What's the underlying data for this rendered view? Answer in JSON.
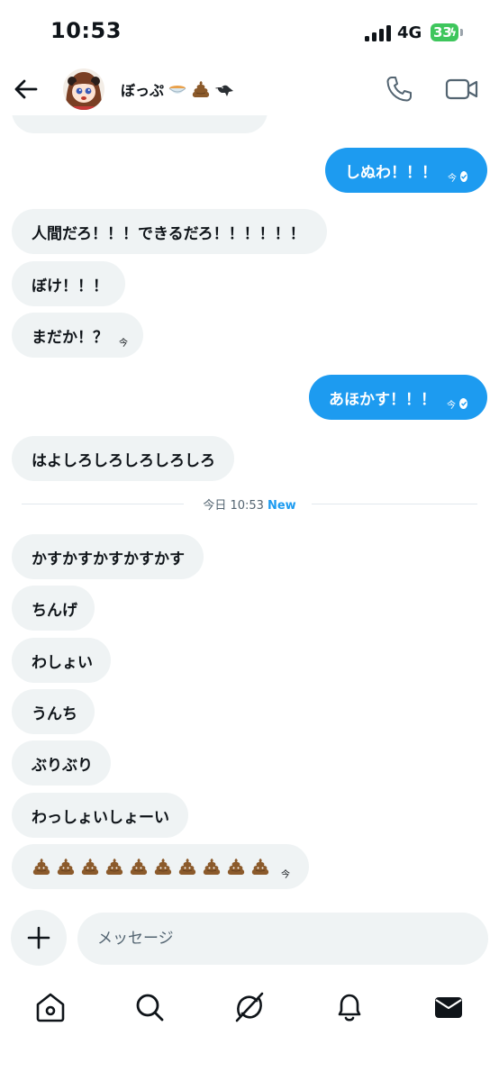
{
  "status": {
    "time": "10:53",
    "network": "4G",
    "battery": "33"
  },
  "header": {
    "name": "ぼっぷ",
    "name_emoji": [
      "bowl-emoji",
      "poop-emoji",
      "crow-emoji"
    ]
  },
  "messages": [
    {
      "side": "recv",
      "text": "",
      "partial": true
    },
    {
      "side": "sent",
      "text": "しぬわ！！！",
      "time": "今",
      "read": true
    },
    {
      "side": "recv",
      "text": "人間だろ！！！できるだろ！！！！！！"
    },
    {
      "side": "recv",
      "text": "ぼけ！！！"
    },
    {
      "side": "recv",
      "text": "まだか！？",
      "time": "今"
    },
    {
      "side": "sent",
      "text": "あほかす！！！",
      "time": "今",
      "read": true
    },
    {
      "side": "recv",
      "text": "はよしろしろしろしろしろ"
    },
    {
      "side": "recv",
      "text": "かすかすかすかすかす"
    },
    {
      "side": "recv",
      "text": "ちんげ"
    },
    {
      "side": "recv",
      "text": "わしょい"
    },
    {
      "side": "recv",
      "text": "うんち"
    },
    {
      "side": "recv",
      "text": "ぶりぶり"
    },
    {
      "side": "recv",
      "text": "わっしょいしょーい"
    },
    {
      "side": "recv",
      "emoji_count": 10,
      "emoji": "poop-emoji",
      "time": "今"
    }
  ],
  "divider": {
    "label": "今日 10:53",
    "new_label": "New"
  },
  "composer": {
    "placeholder": "メッセージ"
  },
  "tabs": [
    "home-icon",
    "search-icon",
    "grok-icon",
    "notifications-icon",
    "messages-icon"
  ],
  "colors": {
    "accent": "#1d9bf0",
    "bubble_received": "#eff3f4",
    "battery": "#3ec65c",
    "text": "#0f1419",
    "muted": "#536471"
  }
}
